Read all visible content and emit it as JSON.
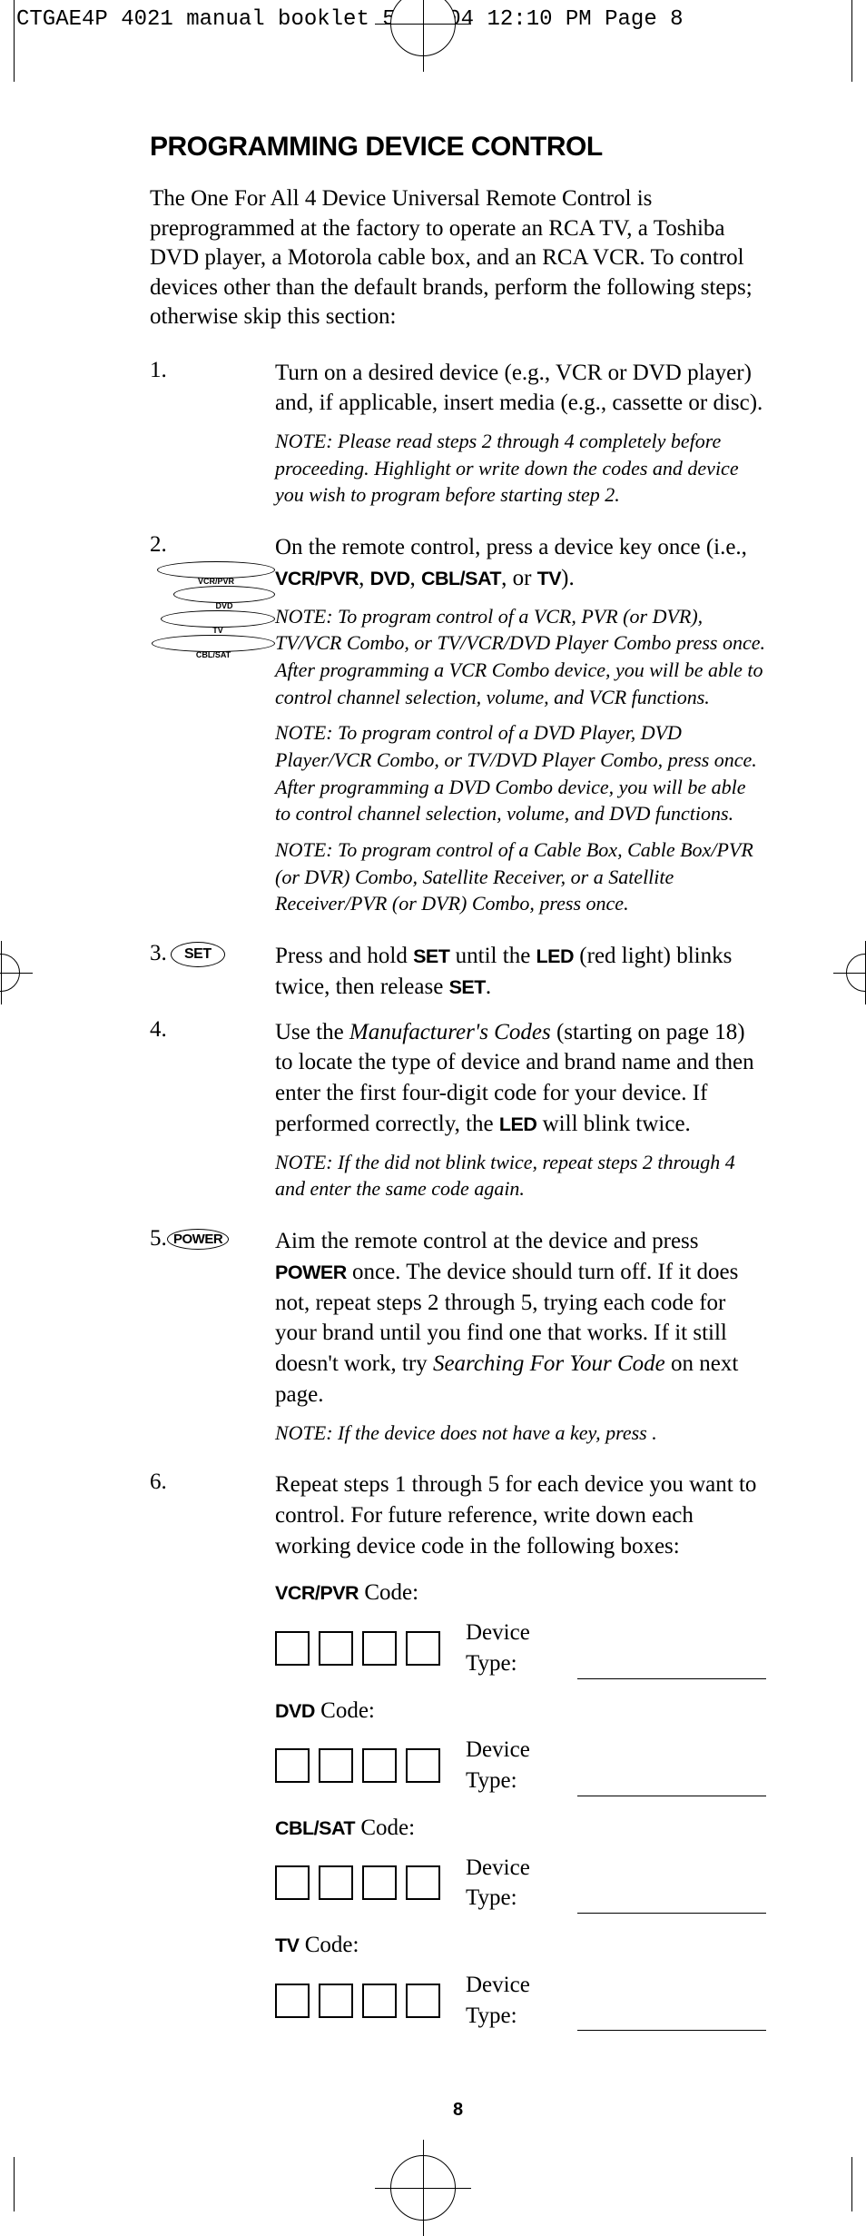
{
  "printmark": "CTGAE4P 4021 manual booklet   5/24/04  12:10 PM  Page 8",
  "title": "PROGRAMMING DEVICE CONTROL",
  "intro": "The One For All 4 Device Universal Remote Control is preprogrammed at the factory to operate an RCA TV,  a Toshiba DVD player, a Motorola cable box, and an RCA VCR. To control devices other than the default brands, perform the following steps; otherwise skip this section:",
  "step1": {
    "num": "1.",
    "text": "Turn on a desired device (e.g., VCR or DVD player) and, if applicable,  insert media (e.g., cassette or disc).",
    "note": "NOTE: Please read steps 2 through 4 completely before proceeding. Highlight or write down the codes and device you wish to program before starting step 2."
  },
  "step2": {
    "num": "2.",
    "pre": "On the remote control, press a device key once (i.e., ",
    "k1": "VCR/PVR",
    "k2": "DVD",
    "k3": "CBL/SAT",
    "k4": "TV",
    "post": ").",
    "note1a": "NOTE: To program control of a VCR, PVR (or DVR), TV/VCR Combo, or TV/VCR/DVD Player Combo press            once. After programming a VCR Combo device, you will be able to control channel selection, volume, and VCR functions.",
    "note2a": "NOTE: To program control of a DVD Player, DVD Player/VCR Combo, or TV/DVD Player Combo, press         once. After programming a DVD Combo device, you will be able to control channel selection, volume, and DVD functions.",
    "note3a": "NOTE: To program control of a Cable Box, Cable Box/PVR (or DVR) Combo, Satellite Receiver, or a Satellite Receiver/PVR (or DVR) Combo, press               once.",
    "icons": {
      "vcrpvr": "VCR/PVR",
      "dvd": "DVD",
      "tv": "TV",
      "cblsat": "CBL/SAT"
    }
  },
  "step3": {
    "num": "3.",
    "key": "SET",
    "pre": "Press and hold ",
    "b1": "SET",
    "mid": " until the ",
    "b2": "LED",
    "mid2": " (red light) blinks twice, then release ",
    "b3": "SET",
    "post": "."
  },
  "step4": {
    "num": "4.",
    "pre": "Use the ",
    "it": "Manufacturer's Codes",
    "mid": " (starting on page 18) to locate the type of device and brand name and then enter the first four-digit code for your device. If performed correctly, the ",
    "b1": "LED",
    "post": " will blink twice.",
    "note": "NOTE: If the         did not blink twice, repeat steps 2 through 4 and enter the same code again."
  },
  "step5": {
    "num": "5.",
    "key": "POWER",
    "pre": "Aim the remote control at the device and press ",
    "b1": "POWER",
    "mid": " once. The device should turn off. If it does not, repeat steps 2 through 5, trying each code for your brand until you find one that works. If it still doesn't work, try ",
    "it": "Searching For Your Code",
    "post": " on next page.",
    "note": "NOTE: If the device does not have a              key, press        ."
  },
  "step6": {
    "num": "6.",
    "text": "Repeat steps 1 through 5 for each device you want to control. For future reference, write down each working device code in the following boxes:"
  },
  "codes": {
    "vcrpvr": "VCR/PVR",
    "dvd": "DVD",
    "cblsat": "CBL/SAT",
    "tv": "TV",
    "suffix": " Code:",
    "devtype": "Device Type:"
  },
  "pagenum": "8"
}
